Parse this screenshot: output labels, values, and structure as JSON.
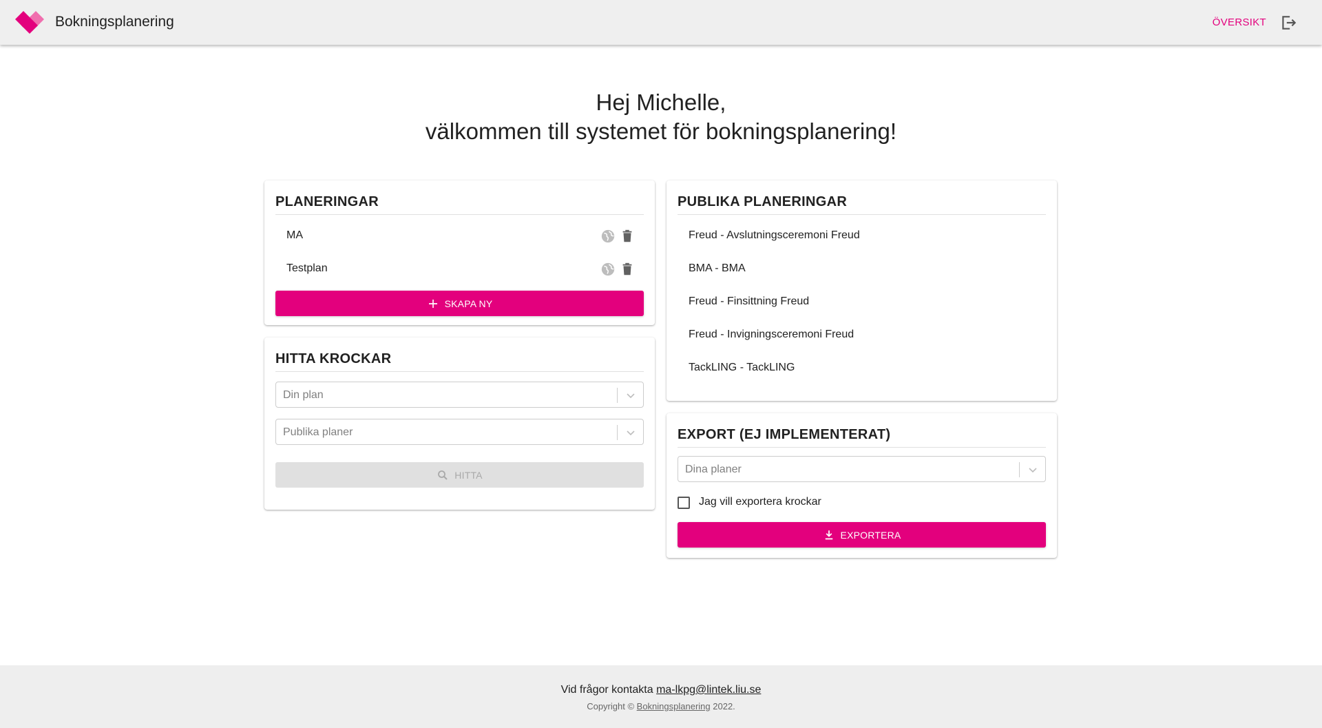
{
  "header": {
    "app_title": "Bokningsplanering",
    "nav_overview": "ÖVERSIKT",
    "brand_color": "#e3007d"
  },
  "greeting": {
    "line1": "Hej Michelle,",
    "line2": "välkommen till systemet för bokningsplanering!"
  },
  "plans": {
    "title": "PLANERINGAR",
    "items": [
      {
        "label": "MA"
      },
      {
        "label": "Testplan"
      }
    ],
    "create_label": "SKAPA NY"
  },
  "collisions": {
    "title": "HITTA KROCKAR",
    "your_plan_placeholder": "Din plan",
    "public_plans_placeholder": "Publika planer",
    "find_label": "HITTA"
  },
  "public_plans": {
    "title": "PUBLIKA PLANERINGAR",
    "items": [
      "Freud - Avslutningsceremoni Freud",
      "BMA - BMA",
      "Freud - Finsittning Freud",
      "Freud - Invigningsceremoni Freud",
      "TackLING - TackLING"
    ]
  },
  "export": {
    "title": "EXPORT (EJ IMPLEMENTERAT)",
    "plans_placeholder": "Dina planer",
    "checkbox_label": "Jag vill exportera krockar",
    "export_label": "EXPORTERA"
  },
  "footer": {
    "contact_text": "Vid frågor kontakta",
    "contact_email": "ma-lkpg@lintek.liu.se",
    "copyright_prefix": "Copyright ©",
    "copyright_link": "Bokningsplanering",
    "copyright_year": "2022."
  }
}
